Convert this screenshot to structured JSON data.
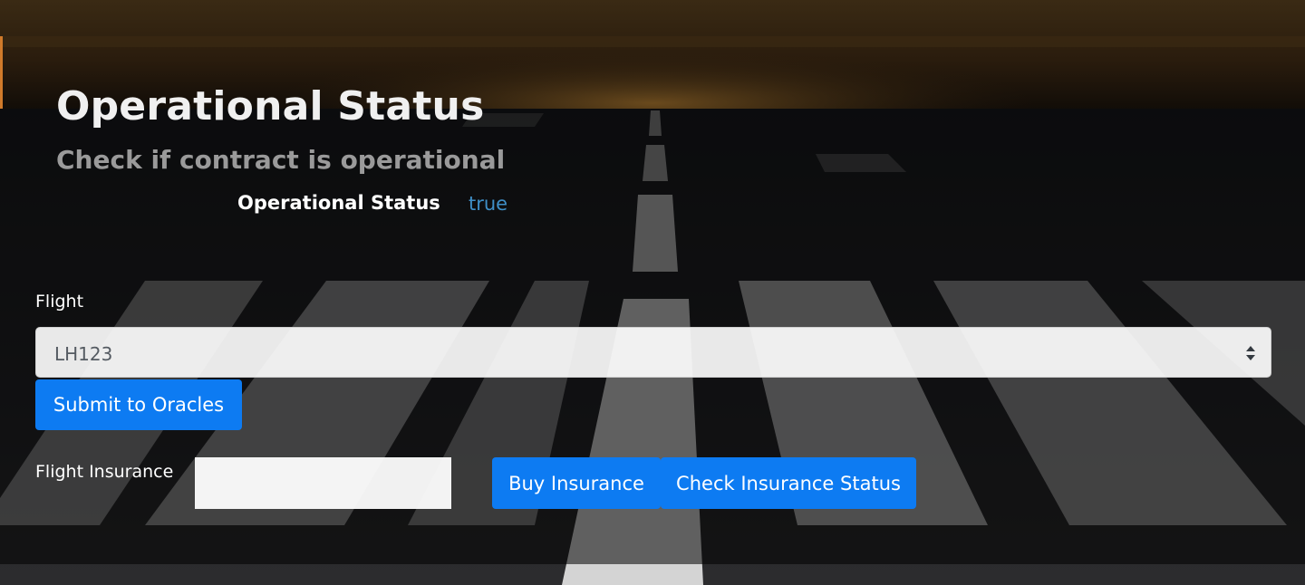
{
  "status_section": {
    "title": "Operational Status",
    "subtitle": "Check if contract is operational",
    "status_label": "Operational Status",
    "status_value": "true"
  },
  "oracle_form": {
    "flight_label": "Flight",
    "flight_selected": "LH123",
    "submit_label": "Submit to Oracles"
  },
  "insurance_form": {
    "label": "Flight Insurance",
    "input_value": "",
    "buy_label": "Buy Insurance",
    "check_label": "Check Insurance Status"
  },
  "colors": {
    "button_blue": "#0d7bf2",
    "status_value_blue": "#3f8fc7",
    "subtitle_gray": "#9a9a9a"
  }
}
